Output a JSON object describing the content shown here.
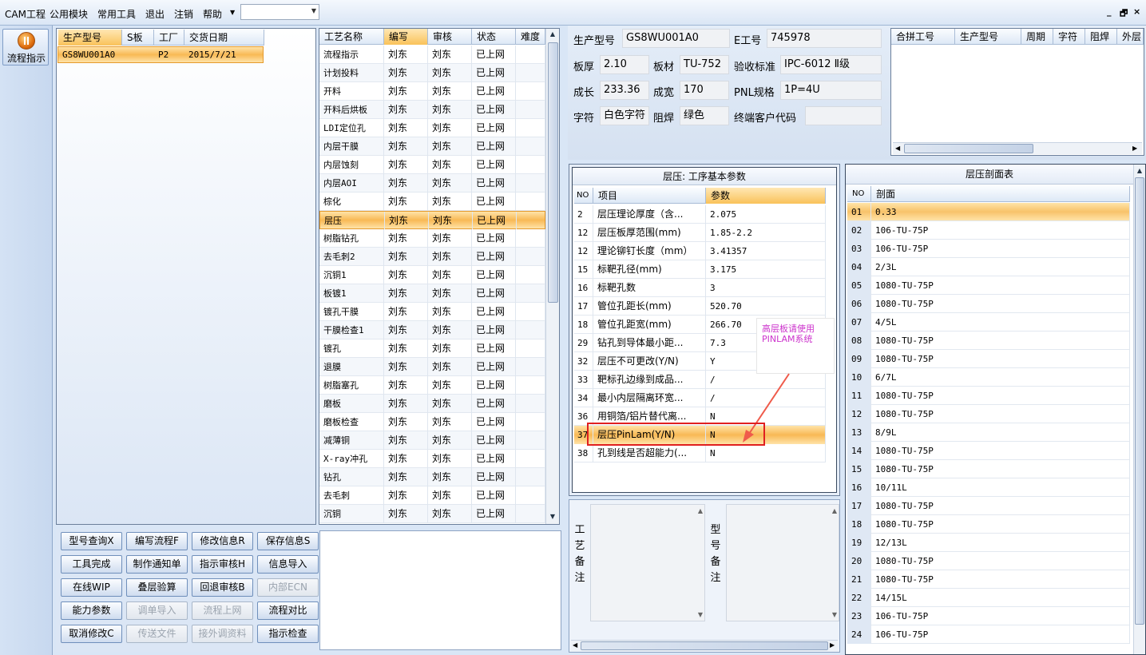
{
  "menubar": {
    "items": [
      "CAM工程",
      "公用模块",
      "常用工具",
      "退出",
      "注销",
      "帮助"
    ],
    "combo_value": "",
    "win_buttons": [
      "_",
      "🗗",
      "×"
    ]
  },
  "leftnav": {
    "flow_label": "流程指示"
  },
  "parts": {
    "headers": [
      "生产型号",
      "S板",
      "工厂",
      "交货日期"
    ],
    "rows": [
      [
        "GS8WU001A0",
        "",
        "P2",
        "2015/7/21"
      ]
    ]
  },
  "process": {
    "headers": [
      "工艺名称",
      "编写",
      "审核",
      "状态",
      "难度"
    ],
    "rows": [
      [
        "流程指示",
        "刘东",
        "刘东",
        "已上网",
        ""
      ],
      [
        "计划投料",
        "刘东",
        "刘东",
        "已上网",
        ""
      ],
      [
        "开料",
        "刘东",
        "刘东",
        "已上网",
        ""
      ],
      [
        "开料后烘板",
        "刘东",
        "刘东",
        "已上网",
        ""
      ],
      [
        "LDI定位孔",
        "刘东",
        "刘东",
        "已上网",
        ""
      ],
      [
        "内层干膜",
        "刘东",
        "刘东",
        "已上网",
        ""
      ],
      [
        "内层蚀刻",
        "刘东",
        "刘东",
        "已上网",
        ""
      ],
      [
        "内层AOI",
        "刘东",
        "刘东",
        "已上网",
        ""
      ],
      [
        "棕化",
        "刘东",
        "刘东",
        "已上网",
        ""
      ],
      [
        "层压",
        "刘东",
        "刘东",
        "已上网",
        ""
      ],
      [
        "树脂钻孔",
        "刘东",
        "刘东",
        "已上网",
        ""
      ],
      [
        "去毛刺2",
        "刘东",
        "刘东",
        "已上网",
        ""
      ],
      [
        "沉铜1",
        "刘东",
        "刘东",
        "已上网",
        ""
      ],
      [
        "板镀1",
        "刘东",
        "刘东",
        "已上网",
        ""
      ],
      [
        "镀孔干膜",
        "刘东",
        "刘东",
        "已上网",
        ""
      ],
      [
        "干膜检查1",
        "刘东",
        "刘东",
        "已上网",
        ""
      ],
      [
        "镀孔",
        "刘东",
        "刘东",
        "已上网",
        ""
      ],
      [
        "退膜",
        "刘东",
        "刘东",
        "已上网",
        ""
      ],
      [
        "树脂塞孔",
        "刘东",
        "刘东",
        "已上网",
        ""
      ],
      [
        "磨板",
        "刘东",
        "刘东",
        "已上网",
        ""
      ],
      [
        "磨板检查",
        "刘东",
        "刘东",
        "已上网",
        ""
      ],
      [
        "减薄铜",
        "刘东",
        "刘东",
        "已上网",
        ""
      ],
      [
        "X-ray冲孔",
        "刘东",
        "刘东",
        "已上网",
        ""
      ],
      [
        "钻孔",
        "刘东",
        "刘东",
        "已上网",
        ""
      ],
      [
        "去毛刺",
        "刘东",
        "刘东",
        "已上网",
        ""
      ],
      [
        "沉铜",
        "刘东",
        "刘东",
        "已上网",
        ""
      ]
    ],
    "selected_index": 9
  },
  "buttons": [
    [
      "型号查询X",
      "编写流程F",
      "修改信息R",
      "保存信息S"
    ],
    [
      "工具完成",
      "制作通知单",
      "指示审核H",
      "信息导入"
    ],
    [
      "在线WIP",
      "叠层验算",
      "回退审核B",
      "内部ECN"
    ],
    [
      "能力参数",
      "调单导入",
      "流程上网",
      "流程对比"
    ],
    [
      "取消修改C",
      "传送文件",
      "接外调资料",
      "指示检查"
    ]
  ],
  "buttons_disabled": [
    "内部ECN",
    "调单导入",
    "流程上网",
    "传送文件",
    "接外调资料"
  ],
  "info": {
    "prod_model_label": "生产型号",
    "prod_model": "GS8WU001A0",
    "e_no_label": "E工号",
    "e_no": "745978",
    "thickness_label": "板厚",
    "thickness": "2.10",
    "material_label": "板材",
    "material": "TU-752",
    "accept_label": "验收标准",
    "accept": "IPC-6012 Ⅱ级",
    "length_label": "成长",
    "length": "233.36",
    "width_label": "成宽",
    "width": "170",
    "pnl_label": "PNL规格",
    "pnl": "1P=4U",
    "char_label": "字符",
    "char": "白色字符",
    "mask_label": "阻焊",
    "mask": "绿色",
    "customer_label": "终端客户代码",
    "customer": ""
  },
  "merge": {
    "headers": [
      "合拼工号",
      "生产型号",
      "周期",
      "字符",
      "阻焊",
      "外层"
    ]
  },
  "params": {
    "title": "层压: 工序基本参数",
    "headers": [
      "NO",
      "项目",
      "参数"
    ],
    "rows": [
      [
        "2",
        "层压理论厚度（含...",
        "2.075"
      ],
      [
        "12",
        "层压板厚范围(mm)",
        "1.85-2.2"
      ],
      [
        "12",
        "理论铆钉长度（mm）",
        "3.41357"
      ],
      [
        "15",
        "标靶孔径(mm)",
        "3.175"
      ],
      [
        "16",
        "标靶孔数",
        "3"
      ],
      [
        "17",
        "管位孔距长(mm)",
        "520.70"
      ],
      [
        "18",
        "管位孔距宽(mm)",
        "266.70"
      ],
      [
        "29",
        "钻孔到导体最小距...",
        "7.3"
      ],
      [
        "32",
        "层压不可更改(Y/N)",
        "Y"
      ],
      [
        "33",
        "靶标孔边缘到成品...",
        "/"
      ],
      [
        "34",
        "最小内层隔离环宽...",
        "/"
      ],
      [
        "36",
        "用铜箔/铝片替代离...",
        "N"
      ],
      [
        "37",
        "层压PinLam(Y/N)",
        "N"
      ],
      [
        "38",
        "孔到线是否超能力(...",
        "N"
      ]
    ],
    "selected_index": 12,
    "callout": "高层板请使用PINLAM系统"
  },
  "notes": {
    "process_label": "工艺备注",
    "model_label": "型号备注"
  },
  "stack": {
    "title": "层压剖面表",
    "headers": [
      "NO",
      "剖面"
    ],
    "rows": [
      [
        "01",
        "0.33"
      ],
      [
        "02",
        "106-TU-75P"
      ],
      [
        "03",
        "106-TU-75P"
      ],
      [
        "04",
        "2/3L"
      ],
      [
        "05",
        "1080-TU-75P"
      ],
      [
        "06",
        "1080-TU-75P"
      ],
      [
        "07",
        "4/5L"
      ],
      [
        "08",
        "1080-TU-75P"
      ],
      [
        "09",
        "1080-TU-75P"
      ],
      [
        "10",
        "6/7L"
      ],
      [
        "11",
        "1080-TU-75P"
      ],
      [
        "12",
        "1080-TU-75P"
      ],
      [
        "13",
        "8/9L"
      ],
      [
        "14",
        "1080-TU-75P"
      ],
      [
        "15",
        "1080-TU-75P"
      ],
      [
        "16",
        "10/11L"
      ],
      [
        "17",
        "1080-TU-75P"
      ],
      [
        "18",
        "1080-TU-75P"
      ],
      [
        "19",
        "12/13L"
      ],
      [
        "20",
        "1080-TU-75P"
      ],
      [
        "21",
        "1080-TU-75P"
      ],
      [
        "22",
        "14/15L"
      ],
      [
        "23",
        "106-TU-75P"
      ],
      [
        "24",
        "106-TU-75P"
      ]
    ]
  }
}
